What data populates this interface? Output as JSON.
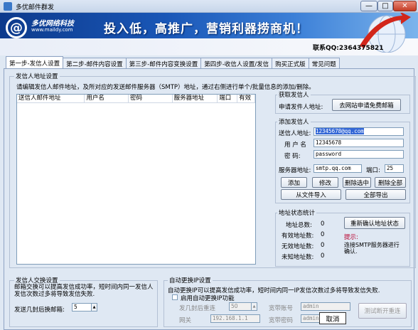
{
  "window": {
    "title": "多优邮件群发",
    "min": "—",
    "max": "□",
    "close": "✕"
  },
  "banner": {
    "logo_letter": "@",
    "brand": "多优网络科技",
    "url": "www.maildy.com",
    "slogan": "投入低，高推广，营销利器捞商机！",
    "qq": "联系QQ:2364375821"
  },
  "tabs": [
    "第一步-发信人设置",
    "第二步-邮件内容设置",
    "第三步-邮件内容变换设置",
    "第四步-收信人设置/发信",
    "购买正式版",
    "常见问题"
  ],
  "sender_group": {
    "title": "发信人地址设置",
    "desc": "请编辑发信人邮件地址，及所对应的发送邮件服务器（SMTP）地址，通过右侧进行单个/批量信息的添加/删除。",
    "columns": [
      "送信人邮件地址",
      "用户名",
      "密码",
      "服务器地址",
      "端口",
      "有效"
    ]
  },
  "get_sender": {
    "title": "获取发信人",
    "label": "申请发件人地址:",
    "button": "去网站申请免费邮箱"
  },
  "add_sender": {
    "title": "添加发信人",
    "email_label": "送信人地址:",
    "email_value": "12345678@qq.com",
    "user_label": "用 户 名",
    "user_value": "12345678",
    "pass_label": "密  码:",
    "pass_value": "password",
    "server_label": "服务器地址:",
    "server_value": "smtp.qq.com",
    "port_label": "端口:",
    "port_value": "25",
    "btn_add": "添加",
    "btn_edit": "修改",
    "btn_del_sel": "删除选中",
    "btn_del_all": "删除全部",
    "btn_import": "从文件导入",
    "btn_export": "全部导出"
  },
  "status": {
    "title": "地址状态统计",
    "total_label": "地址总数:",
    "total": "0",
    "valid_label": "有效地址数:",
    "valid": "0",
    "invalid_label": "无效地址数:",
    "invalid": "0",
    "unknown_label": "未知地址数:",
    "unknown": "0",
    "btn_reconfirm": "重新确认地址状态",
    "hint_title": "提示:",
    "hint_text": "连接SMTP服务器进行确认."
  },
  "swap": {
    "title": "发信人交换设置",
    "desc": "邮箱交换可以提高发信成功率，短时间内同一发信人发信次数过多将导致发信失败.",
    "label": "发送几封后换邮箱:",
    "value": "5"
  },
  "ip": {
    "title": "自动更换IP设置",
    "desc": "自动更换IP可以提高发信成功率，短时间内同一IP发信次数过多将导致发信失败.",
    "check_label": "启用自动更换IP功能",
    "count_label": "发几封后重连",
    "count_value": "50",
    "account_label": "宽带账号",
    "account_value": "admin",
    "gateway_label": "网关",
    "gateway_value": "192.168.1.1",
    "pwd_label": "宽带密码",
    "pwd_value": "admin",
    "cancel": "取消",
    "test_btn": "测试断开重连"
  }
}
